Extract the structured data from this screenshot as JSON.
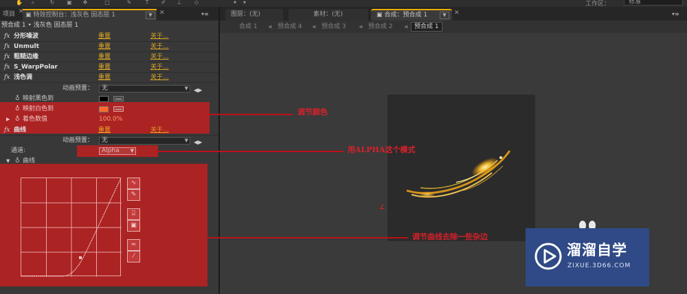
{
  "toolbar": {
    "workspace_label": "工作区：",
    "workspace_value": "标准"
  },
  "left_panel": {
    "tabs": {
      "project": "项目",
      "effect_controls": "特效控制台：浅灰色 固态层 1"
    },
    "breadcrumb": "预合成 1 • 浅灰色 固态层 1",
    "effects": [
      {
        "name": "分形噪波",
        "reset": "重置",
        "about": "关于..."
      },
      {
        "name": "Unmult",
        "reset": "重置",
        "about": "关于..."
      },
      {
        "name": "粗糙边缘",
        "reset": "重置",
        "about": "关于..."
      },
      {
        "name": "S_WarpPolar",
        "reset": "重置",
        "about": "关于..."
      },
      {
        "name": "浅色调",
        "reset": "重置",
        "about": "关于..."
      }
    ],
    "tint": {
      "preset_label": "动画预置：",
      "preset_value": "无",
      "map_black_label": "映射黑色到",
      "map_white_label": "映射白色到",
      "amount_label": "着色数值",
      "amount_value": "100.0%",
      "map_black_color": "#000000",
      "map_white_color": "#ff6a2a"
    },
    "curves": {
      "name": "曲线",
      "reset": "重置",
      "about": "关于...",
      "preset_label": "动画预置：",
      "preset_value": "无",
      "channel_label": "通道:",
      "channel_value": "Alpha",
      "curve_label": "曲线"
    },
    "fx_icon": "fx"
  },
  "right_panel": {
    "tabs": {
      "layer": "图层：(无)",
      "footage": "素材：(无)",
      "composition": "合成：预合成 1"
    },
    "flowchart": [
      "合成 1",
      "预合成 4",
      "预合成 3",
      "预合成 2",
      "预合成 1"
    ]
  },
  "annotations": {
    "color": "调节颜色",
    "alpha": "用ALPHA这个模式",
    "curve": "调节曲线去除一些杂边"
  },
  "watermark": {
    "title": "溜溜自学",
    "url": "ZIXUE.3D66.COM",
    "bg_color": "#2f4a86"
  },
  "colors": {
    "accent_tab": "#f0ad00",
    "link": "#e0a823",
    "annotation": "#c0101a"
  }
}
